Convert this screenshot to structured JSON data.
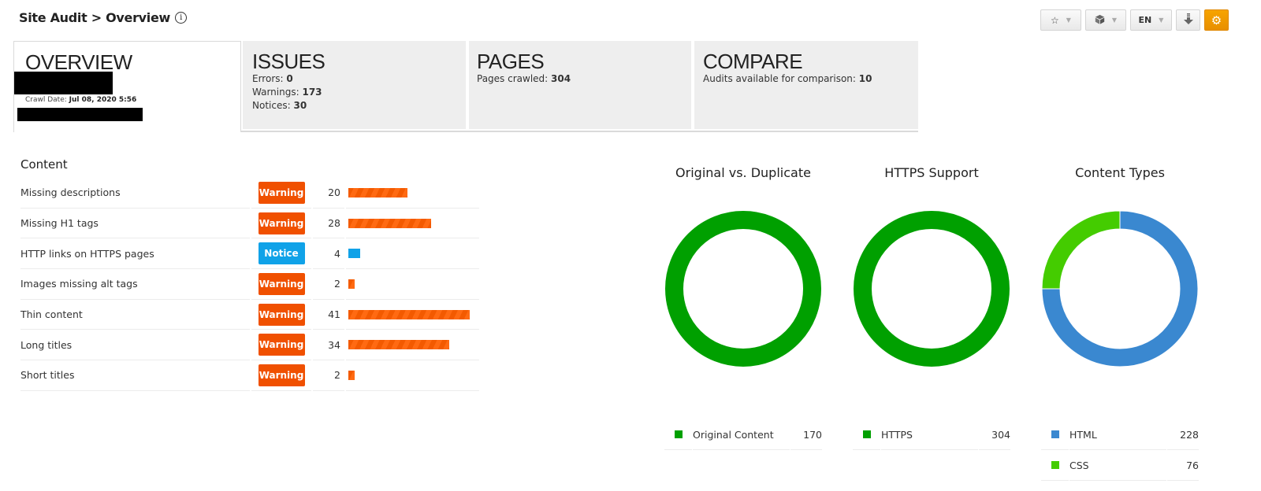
{
  "header": {
    "title": "Site Audit > Overview",
    "info_icon": "info-circle-icon"
  },
  "toolbar": {
    "star_icon": "star-icon",
    "box_icon": "cube-icon",
    "language": "EN",
    "download_icon": "download-icon",
    "settings_icon": "gear-icon",
    "settings_color": "#f39c00"
  },
  "tabs": {
    "overview": {
      "title": "OVERVIEW",
      "crawl_date_label": "Crawl Date:",
      "crawl_date_value": "Jul 08, 2020 5:56"
    },
    "issues": {
      "title": "ISSUES",
      "lines": [
        {
          "label": "Errors:",
          "value": "0"
        },
        {
          "label": "Warnings:",
          "value": "173"
        },
        {
          "label": "Notices:",
          "value": "30"
        }
      ]
    },
    "pages": {
      "title": "PAGES",
      "lines": [
        {
          "label": "Pages crawled:",
          "value": "304"
        }
      ]
    },
    "compare": {
      "title": "COMPARE",
      "lines": [
        {
          "label": "Audits available for comparison:",
          "value": "10"
        }
      ]
    }
  },
  "content": {
    "title": "Content",
    "max_count": 41,
    "rows": [
      {
        "name": "Missing descriptions",
        "severity": "Warning",
        "count": 20
      },
      {
        "name": "Missing H1 tags",
        "severity": "Warning",
        "count": 28
      },
      {
        "name": "HTTP links on HTTPS pages",
        "severity": "Notice",
        "count": 4
      },
      {
        "name": "Images missing alt tags",
        "severity": "Warning",
        "count": 2
      },
      {
        "name": "Thin content",
        "severity": "Warning",
        "count": 41
      },
      {
        "name": "Long titles",
        "severity": "Warning",
        "count": 34
      },
      {
        "name": "Short titles",
        "severity": "Warning",
        "count": 2
      }
    ]
  },
  "colors": {
    "warning": "#f05000",
    "notice": "#10a2e8"
  },
  "chart_data": [
    {
      "type": "pie",
      "title": "Original vs. Duplicate",
      "categories": [
        "Original Content"
      ],
      "values": [
        170
      ],
      "colors": [
        "#00a000"
      ]
    },
    {
      "type": "pie",
      "title": "HTTPS Support",
      "categories": [
        "HTTPS"
      ],
      "values": [
        304
      ],
      "colors": [
        "#00a000"
      ]
    },
    {
      "type": "pie",
      "title": "Content Types",
      "categories": [
        "HTML",
        "CSS"
      ],
      "values": [
        228,
        76
      ],
      "colors": [
        "#3a88d0",
        "#44cc00"
      ]
    }
  ]
}
